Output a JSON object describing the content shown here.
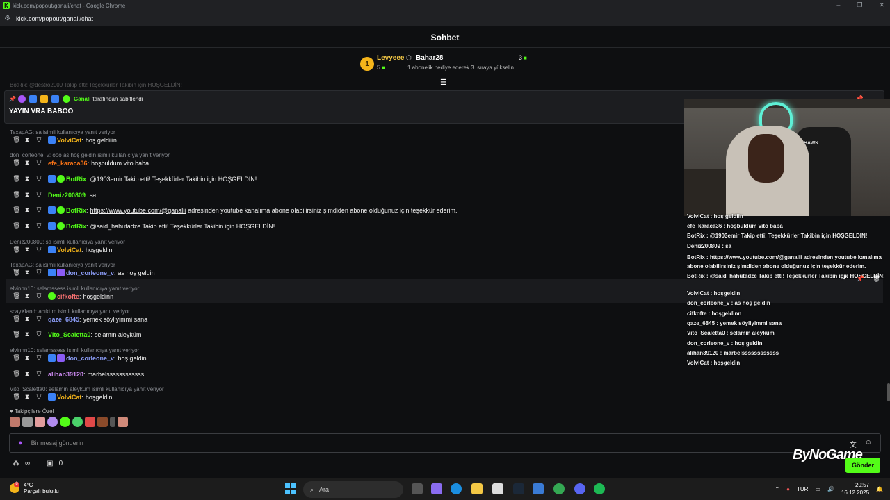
{
  "browser": {
    "window_title": "kick.com/popout/ganali/chat - Google Chrome",
    "url": "kick.com/popout/ganali/chat"
  },
  "chat_header": {
    "title": "Sohbet"
  },
  "leaderboard": {
    "rank": "1",
    "top_user": "Levyeee",
    "top_count": "5",
    "second_user": "Bahar28",
    "second_count": "3",
    "note": "1 abonelik hediye ederek 3. sıraya yükselin"
  },
  "faded_row_text": "BotRix: @destro2009 Takip etti! Teşekkürler Takibin için HOŞGELDİN!",
  "pinned": {
    "pinned_by_user": "Ganali",
    "pinned_by_suffix": "tarafından sabitlendi",
    "message": "YAYIN VRA BABOO"
  },
  "messages": [
    {
      "reply": "TexapAG: sa isimli kullanıcıya yanıt veriyor",
      "user": "VolviCat",
      "color": "#f4b41a",
      "text": "hoş geldiiin",
      "badges": [
        "blue"
      ]
    },
    {
      "reply": "don_corleone_v: ooo as hoş geldin isimli kullanıcıya yanıt veriyor",
      "user": "efe_karaca36",
      "color": "#f97316",
      "text": "hoşbuldum vito baba",
      "badges": []
    },
    {
      "reply": "",
      "user": "BotRix",
      "color": "#53fc18",
      "text": "@1903emir Takip etti! Teşekkürler Takibin için HOŞGELDİN!",
      "badges": [
        "blue",
        "green"
      ]
    },
    {
      "reply": "",
      "user": "Deniz200809",
      "color": "#53fc18",
      "text": "sa",
      "badges": []
    },
    {
      "reply": "",
      "user": "BotRix",
      "color": "#53fc18",
      "text": "adresinden youtube kanalıma abone olabilirsiniz şimdiden abone olduğunuz için teşekkür ederim.",
      "link": "https://www.youtube.com/@ganalii",
      "badges": [
        "blue",
        "green"
      ]
    },
    {
      "reply": "",
      "user": "BotRix",
      "color": "#53fc18",
      "text": "@said_hahutadze Takip etti! Teşekkürler Takibin için HOŞGELDİN!",
      "badges": [
        "blue",
        "green"
      ]
    },
    {
      "reply": "Deniz200809: sa isimli kullanıcıya yanıt veriyor",
      "user": "VolviCat",
      "color": "#f4b41a",
      "text": "hoşgeldin",
      "badges": [
        "blue"
      ]
    },
    {
      "reply": "TexapAG: sa isimli kullanıcıya yanıt veriyor",
      "user": "don_corleone_v",
      "color": "#8b9cf6",
      "text": "as hoş geldin",
      "badges": [
        "blue",
        "purple"
      ]
    },
    {
      "reply": "elvinnn10: selamssess isimli kullanıcıya yanıt veriyor",
      "user": "cifkofte",
      "color": "#f87171",
      "text": "hoşgeldinn",
      "badges": [
        "green"
      ]
    },
    {
      "reply": "scayXland: acıktım isimli kullanıcıya yanıt veriyor",
      "user": "qaze_6845",
      "color": "#8b9cf6",
      "text": "yemek söyliyimmi sana",
      "badges": []
    },
    {
      "reply": "",
      "user": "Vito_Scaletta0",
      "color": "#53fc18",
      "text": "selamın aleyküm",
      "badges": []
    },
    {
      "reply": "elvinnn10: selamssess isimli kullanıcıya yanıt veriyor",
      "user": "don_corleone_v",
      "color": "#8b9cf6",
      "text": "hoş geldin",
      "badges": [
        "blue",
        "purple"
      ]
    },
    {
      "reply": "",
      "user": "alihan39120",
      "color": "#d08cf6",
      "text": "marbelssssssssssss",
      "badges": []
    },
    {
      "reply": "Vito_Scaletta0: selamın aleyküm isimli kullanıcıya yanıt veriyor",
      "user": "VolviCat",
      "color": "#f4b41a",
      "text": "hoşgeldin",
      "badges": [
        "blue"
      ]
    }
  ],
  "followers_only_label": "Takipçilere Özel",
  "input": {
    "placeholder": "Bir mesaj gönderin"
  },
  "footer": {
    "infinity": "∞",
    "points": "0",
    "send_label": "Gönder"
  },
  "watermark": "ByNoGame",
  "overlay": {
    "lines": [
      "VolviCat : hoş geldiin",
      "efe_karaca36 : hoşbuldum vito baba",
      "BotRix : @1903emir Takip etti! Teşekkürler Takibin için HOŞGELDİN!",
      "Deniz200809 : sa",
      "BotRix : https://www.youtube.com/@ganalii adresinden youtube kanalıma abone olabilirsiniz şimdiden abone olduğunuz için teşekkür ederim.",
      "BotRix : @said_hahutadze Takip etti! Teşekkürler Takibin için HOŞGELDİN!",
      "VolviCat : hoşgeldin",
      "don_corleone_v : as hoş geldin",
      "cifkofte : hoşgeldinn",
      "qaze_6845 : yemek söyliyimmi sana",
      "Vito_Scaletta0 : selamın aleyküm",
      "don_corleone_v : hoş geldin",
      "alihan39120 : marbelssssssssssss",
      "VolviCat : hoşgeldin"
    ],
    "chair_brand": "HAWK"
  },
  "taskbar": {
    "temperature": "4°C",
    "weather": "Parçalı bulutlu",
    "weather_badge": "8",
    "search_label": "Ara",
    "language": "TUR",
    "time": "20:57",
    "date": "16.12.2025"
  },
  "colors": {
    "kick_green": "#53fc18",
    "background": "#0e0f11",
    "gold": "#f4b41a"
  }
}
